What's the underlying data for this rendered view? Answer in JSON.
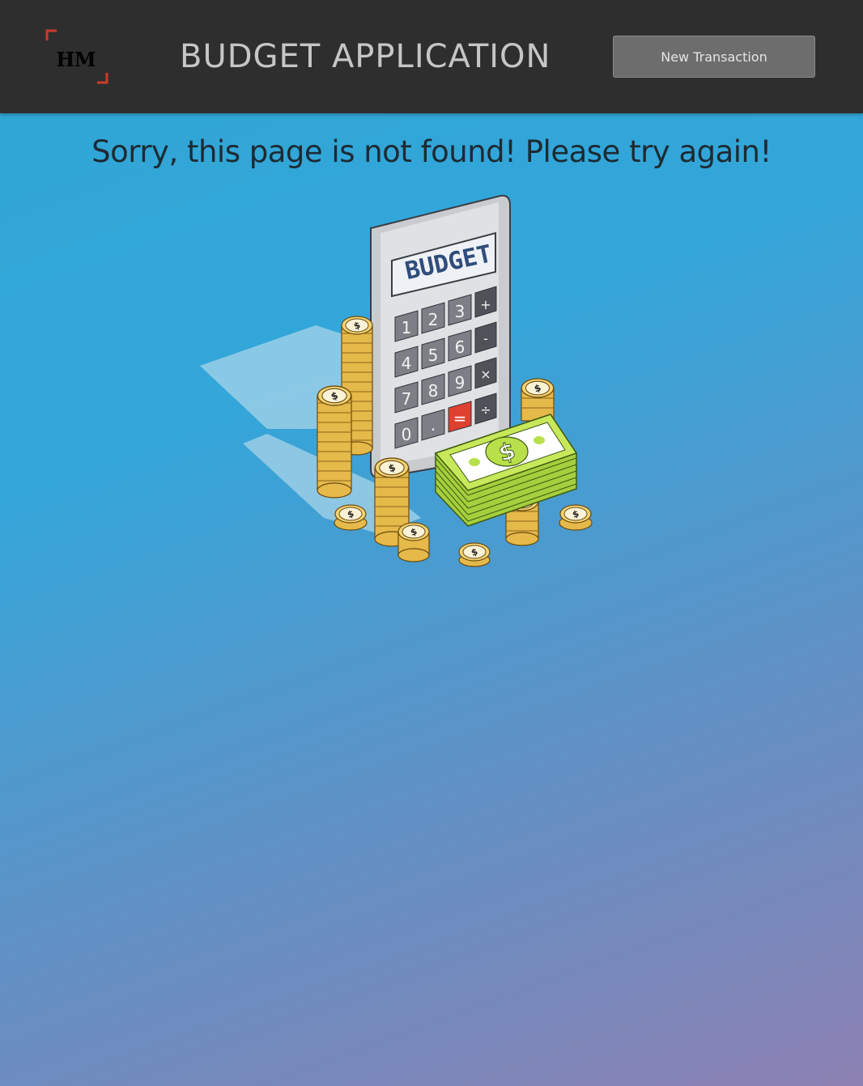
{
  "header": {
    "logo_text": "HM",
    "title": "BUDGET APPLICATION",
    "new_transaction_label": "New Transaction"
  },
  "main": {
    "message": "Sorry, this page is not found! Please try again!",
    "illustration": {
      "display_text": "BUDGET",
      "keys": [
        "1",
        "2",
        "3",
        "+",
        "4",
        "5",
        "6",
        "-",
        "7",
        "8",
        "9",
        "×",
        "0",
        ".",
        "=",
        "÷"
      ],
      "coin_symbol": "$",
      "bill_symbol": "$"
    }
  },
  "colors": {
    "header_bg": "#2f2e2e",
    "button_bg": "#6e6d6d",
    "logo_accent": "#d0392b",
    "equals_key": "#e0402f",
    "bill_green": "#b7e04a",
    "coin_gold": "#e5b94a"
  }
}
